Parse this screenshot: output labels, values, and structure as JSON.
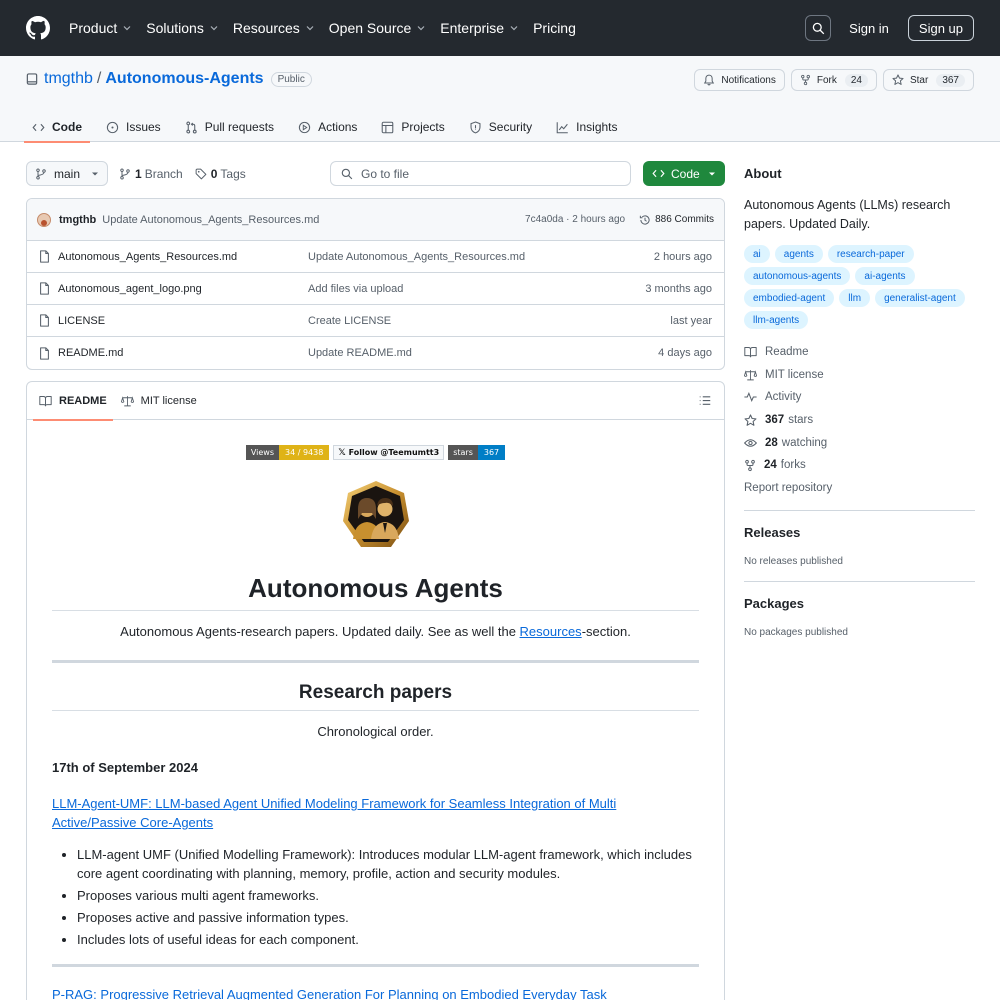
{
  "header": {
    "nav": [
      "Product",
      "Solutions",
      "Resources",
      "Open Source",
      "Enterprise",
      "Pricing"
    ],
    "sign_in": "Sign in",
    "sign_up": "Sign up"
  },
  "repo": {
    "owner": "tmgthb",
    "name": "Autonomous-Agents",
    "visibility": "Public",
    "notifications_label": "Notifications",
    "fork_label": "Fork",
    "fork_count": "24",
    "star_label": "Star",
    "star_count": "367",
    "tabs": [
      "Code",
      "Issues",
      "Pull requests",
      "Actions",
      "Projects",
      "Security",
      "Insights"
    ]
  },
  "toolbar": {
    "branch": "main",
    "branch_count": "1",
    "branch_label": "Branch",
    "tag_count": "0",
    "tag_label": "Tags",
    "goto_placeholder": "Go to file",
    "code_label": "Code"
  },
  "commit": {
    "author": "tmgthb",
    "message": "Update Autonomous_Agents_Resources.md",
    "meta": "7c4a0da · 2 hours ago",
    "commits": "886 Commits"
  },
  "files": [
    {
      "name": "Autonomous_Agents_Resources.md",
      "message": "Update Autonomous_Agents_Resources.md",
      "age": "2 hours ago"
    },
    {
      "name": "Autonomous_agent_logo.png",
      "message": "Add files via upload",
      "age": "3 months ago"
    },
    {
      "name": "LICENSE",
      "message": "Create LICENSE",
      "age": "last year"
    },
    {
      "name": "README.md",
      "message": "Update README.md",
      "age": "4 days ago"
    }
  ],
  "readme": {
    "tabs": [
      "README",
      "MIT license"
    ],
    "badges": {
      "views_label": "Views",
      "views_value": "34 / 9438",
      "follow": "Follow @Teemumtt3",
      "stars_label": "stars",
      "stars_value": "367"
    },
    "title": "Autonomous Agents",
    "intro_before": "Autonomous Agents-research papers. Updated daily. See as well the ",
    "intro_link": "Resources",
    "intro_after": "-section.",
    "section_title": "Research papers",
    "section_sub": "Chronological order.",
    "date_heading": "17th of September 2024",
    "paper_link": "LLM-Agent-UMF: LLM-based Agent Unified Modeling Framework for Seamless Integration of Multi Active/Passive Core-Agents",
    "bullets": [
      "LLM-agent UMF (Unified Modelling Framework): Introduces modular LLM-agent framework, which includes core agent coordinating with planning, memory, profile, action and security modules.",
      "Proposes various multi agent frameworks.",
      "Proposes active and passive information types.",
      "Includes lots of useful ideas for each component."
    ],
    "next_link": "P-RAG: Progressive Retrieval Augmented Generation For Planning on Embodied Everyday Task"
  },
  "sidebar": {
    "about": "About",
    "description": "Autonomous Agents (LLMs) research papers. Updated Daily.",
    "topics": [
      "ai",
      "agents",
      "research-paper",
      "autonomous-agents",
      "ai-agents",
      "embodied-agent",
      "llm",
      "generalist-agent",
      "llm-agents"
    ],
    "readme": "Readme",
    "license": "MIT license",
    "activity": "Activity",
    "stars_count": "367",
    "stars_label": "stars",
    "watching_count": "28",
    "watching_label": "watching",
    "forks_count": "24",
    "forks_label": "forks",
    "report": "Report repository",
    "releases": "Releases",
    "releases_text": "No releases published",
    "packages": "Packages",
    "packages_text": "No packages published"
  },
  "colors": {
    "header_bg": "#24292f",
    "link": "#0969da",
    "green": "#1f883d",
    "tab_underline": "#fd8c73"
  }
}
